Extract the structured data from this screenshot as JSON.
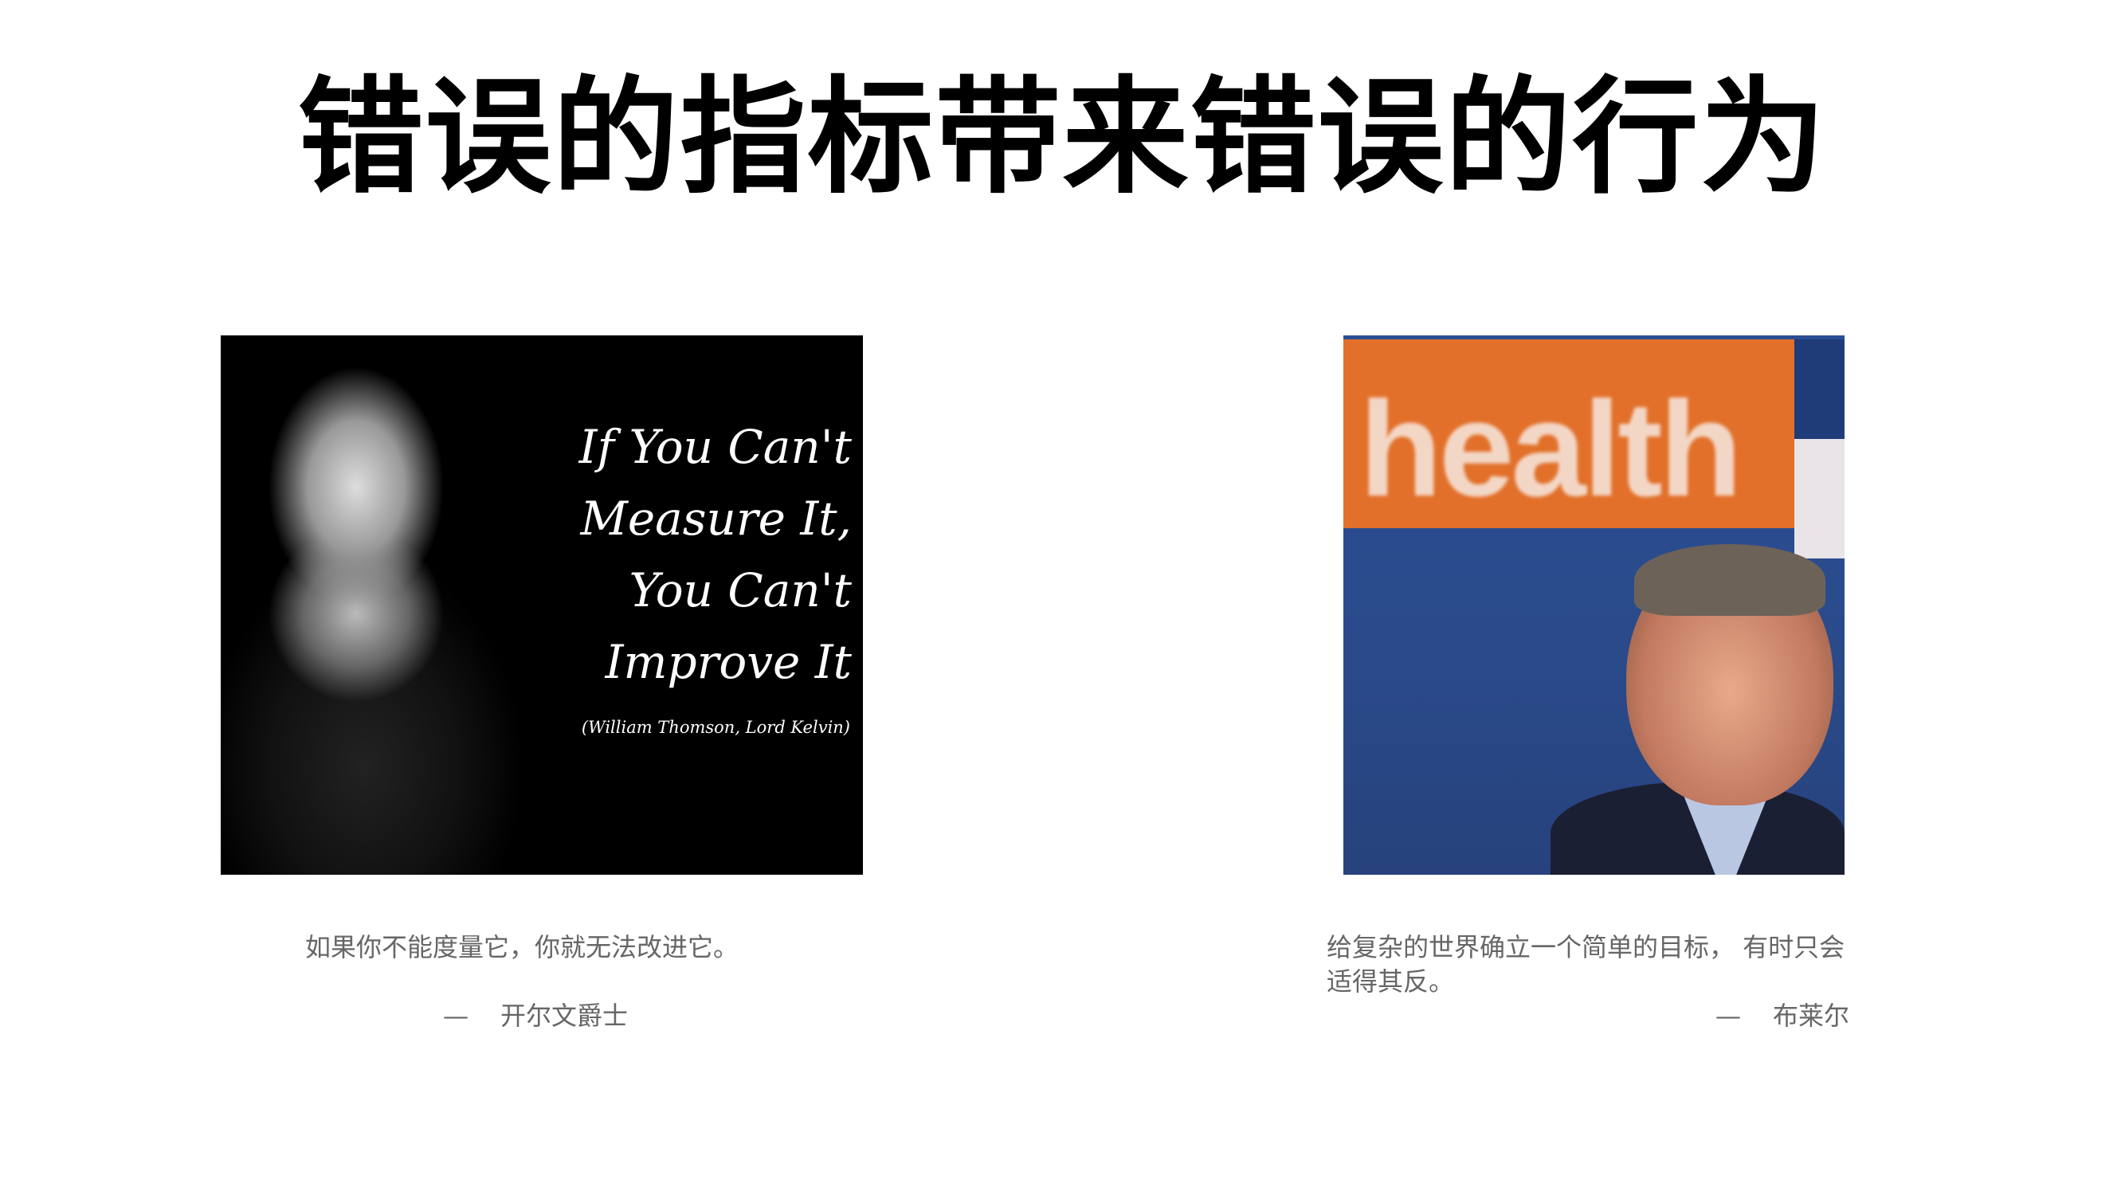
{
  "slide": {
    "title": "错误的指标带来错误的行为",
    "left": {
      "image_text": [
        "If You Can't",
        "Measure It,",
        "You Can't",
        "Improve It"
      ],
      "image_attribution": "(William Thomson, Lord Kelvin)",
      "caption": "如果你不能度量它，你就无法改进它。",
      "dash": "—",
      "author": "开尔文爵士"
    },
    "right": {
      "image_text": "health",
      "caption": "给复杂的世界确立一个简单的目标， 有时只会适得其反。",
      "dash": "—",
      "author": "布莱尔"
    }
  }
}
